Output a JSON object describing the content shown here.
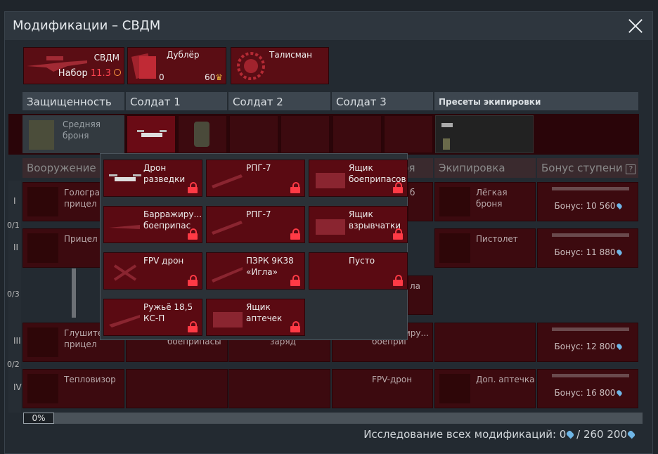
{
  "window": {
    "title": "Модификации – СВДМ"
  },
  "header": {
    "weapon": {
      "name": "СВДМ",
      "set_label": "Набор",
      "set_value": "11.3"
    },
    "duplicate": {
      "name": "Дублёр",
      "count": "0",
      "price": "60"
    },
    "talisman": {
      "name": "Талисман"
    }
  },
  "columns": [
    "Защищенность",
    "Солдат 1",
    "Солдат 2",
    "Солдат 3",
    "Пресеты экипировки"
  ],
  "protection": {
    "label": "Средняя броня"
  },
  "subheaders": {
    "weapons": "Вооружение",
    "soldier3_tail": "ря",
    "equipment": "Экипировка",
    "bonus": "Бонус ступени",
    "help": "?"
  },
  "ranks": [
    "I",
    "II",
    "III",
    "IV"
  ],
  "fractions": [
    "0/1",
    "0/3",
    "0/2"
  ],
  "weapons_col": [
    "Голограф прицел",
    "Прицел 4",
    "Глушител прицел",
    "Тепловизор"
  ],
  "soldier_col_hidden": [
    "боеприпасы",
    "заряд",
    "боеприпасы",
    "FPV-дрон"
  ],
  "soldier_partial": [
    "б",
    "ла",
    "иру..."
  ],
  "equipment_col": [
    "Лёгкая броня",
    "Пистолет",
    "",
    "Доп. аптечка"
  ],
  "bonus_col": [
    {
      "label": "Бонус:",
      "value": "10 560"
    },
    {
      "label": "Бонус:",
      "value": "11 880"
    },
    {
      "label": "Бонус:",
      "value": "12 800"
    },
    {
      "label": "Бонус:",
      "value": "16 800"
    }
  ],
  "popup": {
    "items": [
      {
        "label": "Дрон разведки",
        "locked": true
      },
      {
        "label": "РПГ-7",
        "locked": true
      },
      {
        "label": "Ящик боеприпасов",
        "locked": true
      },
      {
        "label": "Барражиру... боеприпас",
        "locked": true
      },
      {
        "label": "РПГ-7",
        "locked": true
      },
      {
        "label": "Ящик взрывчатки",
        "locked": true
      },
      {
        "label": "FPV дрон",
        "locked": true
      },
      {
        "label": "ПЗРК 9К38 «Игла»",
        "locked": true
      },
      {
        "label": "Пусто",
        "locked": true
      },
      {
        "label": "Ружьё 18,5 КС-П",
        "locked": true
      },
      {
        "label": "Ящик аптечек",
        "locked": true
      }
    ]
  },
  "progress": {
    "percent_label": "0%",
    "value": 0
  },
  "research": {
    "label": "Исследование всех модификаций:",
    "current": "0",
    "sep": "/",
    "total": "260 200"
  },
  "colors": {
    "accent_red": "#5a0a12",
    "lock_red": "#ff3a45",
    "gem_blue": "#6fb6e6"
  }
}
